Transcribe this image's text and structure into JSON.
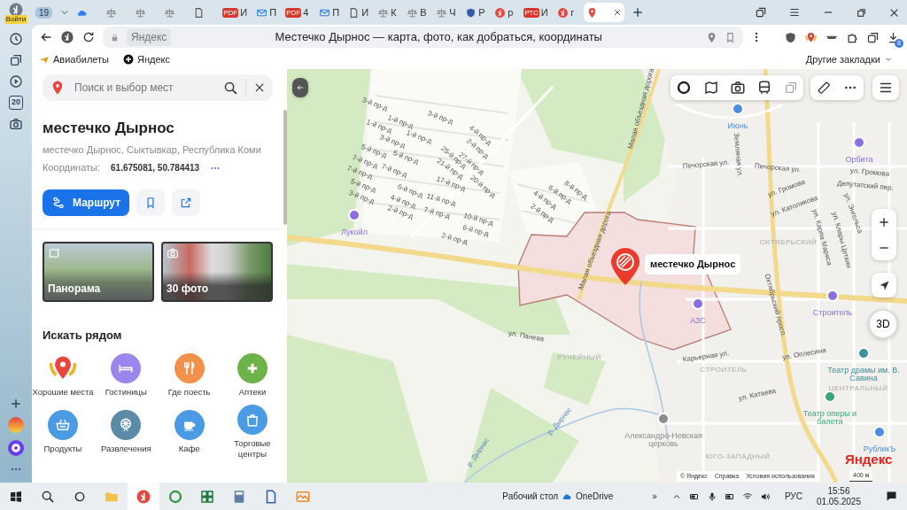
{
  "browser": {
    "profile": {
      "label": "Войти"
    },
    "tab_counter": "19",
    "tabs": [
      {
        "kind": "cloud",
        "selected": false
      },
      {
        "kind": "scales",
        "selected": false
      },
      {
        "kind": "scales",
        "selected": false
      },
      {
        "kind": "scales",
        "selected": false
      },
      {
        "kind": "doc",
        "selected": false
      },
      {
        "kind": "badge",
        "icon_text": "PDF",
        "text": "И",
        "selected": false
      },
      {
        "kind": "mail",
        "text": "П",
        "selected": false
      },
      {
        "kind": "badge",
        "icon_text": "PDF",
        "text": "4",
        "selected": false
      },
      {
        "kind": "mail",
        "text": "П",
        "selected": false
      },
      {
        "kind": "doc",
        "text": "И",
        "selected": false
      },
      {
        "kind": "scales",
        "text": "К",
        "selected": false
      },
      {
        "kind": "scales",
        "text": "В",
        "selected": false
      },
      {
        "kind": "scales",
        "text": "Ч",
        "selected": false
      },
      {
        "kind": "shield",
        "text": "Р",
        "selected": false
      },
      {
        "kind": "ya",
        "text": "р",
        "selected": false
      },
      {
        "kind": "badge",
        "icon_text": "РТС",
        "text": "И",
        "selected": false
      },
      {
        "kind": "ya",
        "text": "г",
        "selected": false
      },
      {
        "kind": "pin",
        "selected": true
      }
    ],
    "address": {
      "domain": "Яндекс",
      "page_title": "Местечко Дырнос — карта, фото, как добраться, координаты",
      "downloads_badge": "8"
    },
    "bookmarks": [
      {
        "kind": "plane",
        "label": "Авиабилеты"
      },
      {
        "kind": "plus",
        "label": "Яндекс"
      }
    ],
    "other_bookmarks": "Другие закладки",
    "sidebar": {
      "calendar_day": "20"
    }
  },
  "search": {
    "placeholder": "Поиск и выбор мест"
  },
  "place": {
    "title": "местечко Дырнос",
    "address": "местечко Дырнос, Сыктывкар, Республика Коми",
    "coords_label": "Координаты:",
    "coords": "61.675081, 50.784413",
    "route_button": "Маршрут"
  },
  "photos": [
    {
      "kind": "panorama",
      "label": "Панорама"
    },
    {
      "kind": "photo",
      "label": "30 фото"
    }
  ],
  "nearby": {
    "title": "Искать рядом",
    "categories": [
      {
        "kind": "award",
        "label": "Хорошие места",
        "color": "#e8453c"
      },
      {
        "kind": "hotel",
        "label": "Гостиницы",
        "color": "#9b86ee"
      },
      {
        "kind": "food",
        "label": "Где поесть",
        "color": "#f2914a"
      },
      {
        "kind": "pharmacy",
        "label": "Аптеки",
        "color": "#6cb348"
      },
      {
        "kind": "grocery",
        "label": "Продукты",
        "color": "#4a9be3"
      },
      {
        "kind": "fun",
        "label": "Развлечения",
        "color": "#5b8ba6"
      },
      {
        "kind": "cafe",
        "label": "Кафе",
        "color": "#4a9be3"
      },
      {
        "kind": "mall",
        "label": "Торговые центры",
        "color": "#4a9be3"
      }
    ]
  },
  "map": {
    "labels": [
      {
        "kind": "street",
        "text": "3-й пр-д"
      },
      {
        "kind": "street",
        "text": "3-й пр-д"
      },
      {
        "kind": "street",
        "text": "1-й пр-д"
      },
      {
        "kind": "street",
        "text": "1-й пр-д"
      },
      {
        "kind": "street",
        "text": "1-й пр-д"
      },
      {
        "kind": "street",
        "text": "3-й пр-д"
      },
      {
        "kind": "street",
        "text": "5-й пр-д"
      },
      {
        "kind": "street",
        "text": "5-й пр-д"
      },
      {
        "kind": "street",
        "text": "7-й пр-д"
      },
      {
        "kind": "street",
        "text": "7-й пр-д"
      },
      {
        "kind": "street",
        "text": "7-й пр-д"
      },
      {
        "kind": "street",
        "text": "5-й пр-д"
      },
      {
        "kind": "street",
        "text": "3-й пр-д"
      },
      {
        "kind": "street",
        "text": "6-й пр-д"
      },
      {
        "kind": "street",
        "text": "4-й пр-д"
      },
      {
        "kind": "street",
        "text": "2-й пр-д"
      },
      {
        "kind": "street",
        "text": "4-й пр-д"
      },
      {
        "kind": "street",
        "text": "2-й пр-д"
      },
      {
        "kind": "street",
        "text": "25-й пр-д"
      },
      {
        "kind": "street",
        "text": "27-й пр-д"
      },
      {
        "kind": "street",
        "text": "21-й пр-д"
      },
      {
        "kind": "street",
        "text": "17-й пр-д"
      },
      {
        "kind": "street",
        "text": "20-й пр-д"
      },
      {
        "kind": "street",
        "text": "11-й пр-д"
      },
      {
        "kind": "street",
        "text": "7-й пр-д"
      },
      {
        "kind": "street",
        "text": "10-й пр-д"
      },
      {
        "kind": "street",
        "text": "6-й пр-д"
      },
      {
        "kind": "street",
        "text": "2-й пр-д"
      },
      {
        "kind": "street",
        "text": "8-й пр-д"
      },
      {
        "kind": "street",
        "text": "6-й пр-д"
      },
      {
        "kind": "street",
        "text": "4-й пр-д"
      },
      {
        "kind": "street",
        "text": "2-й пр-д"
      },
      {
        "kind": "poi",
        "text": "Лукойл",
        "color": "#8a6fe0"
      },
      {
        "kind": "street",
        "text": "Малая объездная дорога"
      },
      {
        "kind": "street",
        "text": "Малая объездная дорога"
      },
      {
        "kind": "street",
        "text": "ул. Панева"
      },
      {
        "kind": "district",
        "text": "РУЧЕЙНЫЙ"
      },
      {
        "kind": "water",
        "text": "р. Дырнас"
      },
      {
        "kind": "water",
        "text": "р. Дырнас"
      },
      {
        "kind": "poi",
        "text": "Александро-Невская церковь",
        "color": "#8c8c8c"
      },
      {
        "kind": "poi",
        "text": "Июнь",
        "color": "#4a8fe0"
      },
      {
        "kind": "poi",
        "text": "Орбита",
        "color": "#8a6fe0"
      },
      {
        "kind": "street",
        "text": "Печорская ул."
      },
      {
        "kind": "street",
        "text": "Печорская ул."
      },
      {
        "kind": "street",
        "text": "Земляная ул."
      },
      {
        "kind": "street",
        "text": "ул. Громова"
      },
      {
        "kind": "street",
        "text": "ул. Громова"
      },
      {
        "kind": "street",
        "text": "Депутатский пер."
      },
      {
        "kind": "street",
        "text": "ул. Католикова"
      },
      {
        "kind": "street",
        "text": "ул. Энгельса"
      },
      {
        "kind": "street",
        "text": "ул. Карла Маркса"
      },
      {
        "kind": "street",
        "text": "ул. Клары Цеткин"
      },
      {
        "kind": "district",
        "text": "ОКТЯБРЬСКИЙ"
      },
      {
        "kind": "street",
        "text": "Октябрьский просп."
      },
      {
        "kind": "poi",
        "text": "АЗС",
        "color": "#8a6fe0"
      },
      {
        "kind": "poi",
        "text": "Строитель",
        "color": "#8a6fe0"
      },
      {
        "kind": "street",
        "text": "Карьерная ул."
      },
      {
        "kind": "district",
        "text": "СТРОИТЕЛЬ"
      },
      {
        "kind": "street",
        "text": "ул. Оплесина"
      },
      {
        "kind": "street",
        "text": "ул. Катаева"
      },
      {
        "kind": "poi",
        "text": "Театр драмы им. В. Савина",
        "color": "#3f8f9a"
      },
      {
        "kind": "district",
        "text": "ЦЕНТРАЛЬНЫЙ"
      },
      {
        "kind": "poi",
        "text": "Театр оперы и балета",
        "color": "#3aa57a"
      },
      {
        "kind": "district",
        "text": "ЮГО-ЗАПАДНЫЙ"
      },
      {
        "kind": "poi",
        "text": "РубликЪ",
        "color": "#4a8fe0"
      }
    ],
    "selected_place": "местечко Дырнос",
    "mode_3d": "3D",
    "logo": "Яндекс",
    "footer": [
      "© Яндекс",
      "Справка",
      "Условия использования"
    ],
    "scale": "400 м"
  },
  "taskbar": {
    "desktop": "Рабочий стол",
    "onedrive": "OneDrive",
    "overflow": "»",
    "lang": "РУС",
    "time": "15:56",
    "date": "01.05.2025"
  }
}
